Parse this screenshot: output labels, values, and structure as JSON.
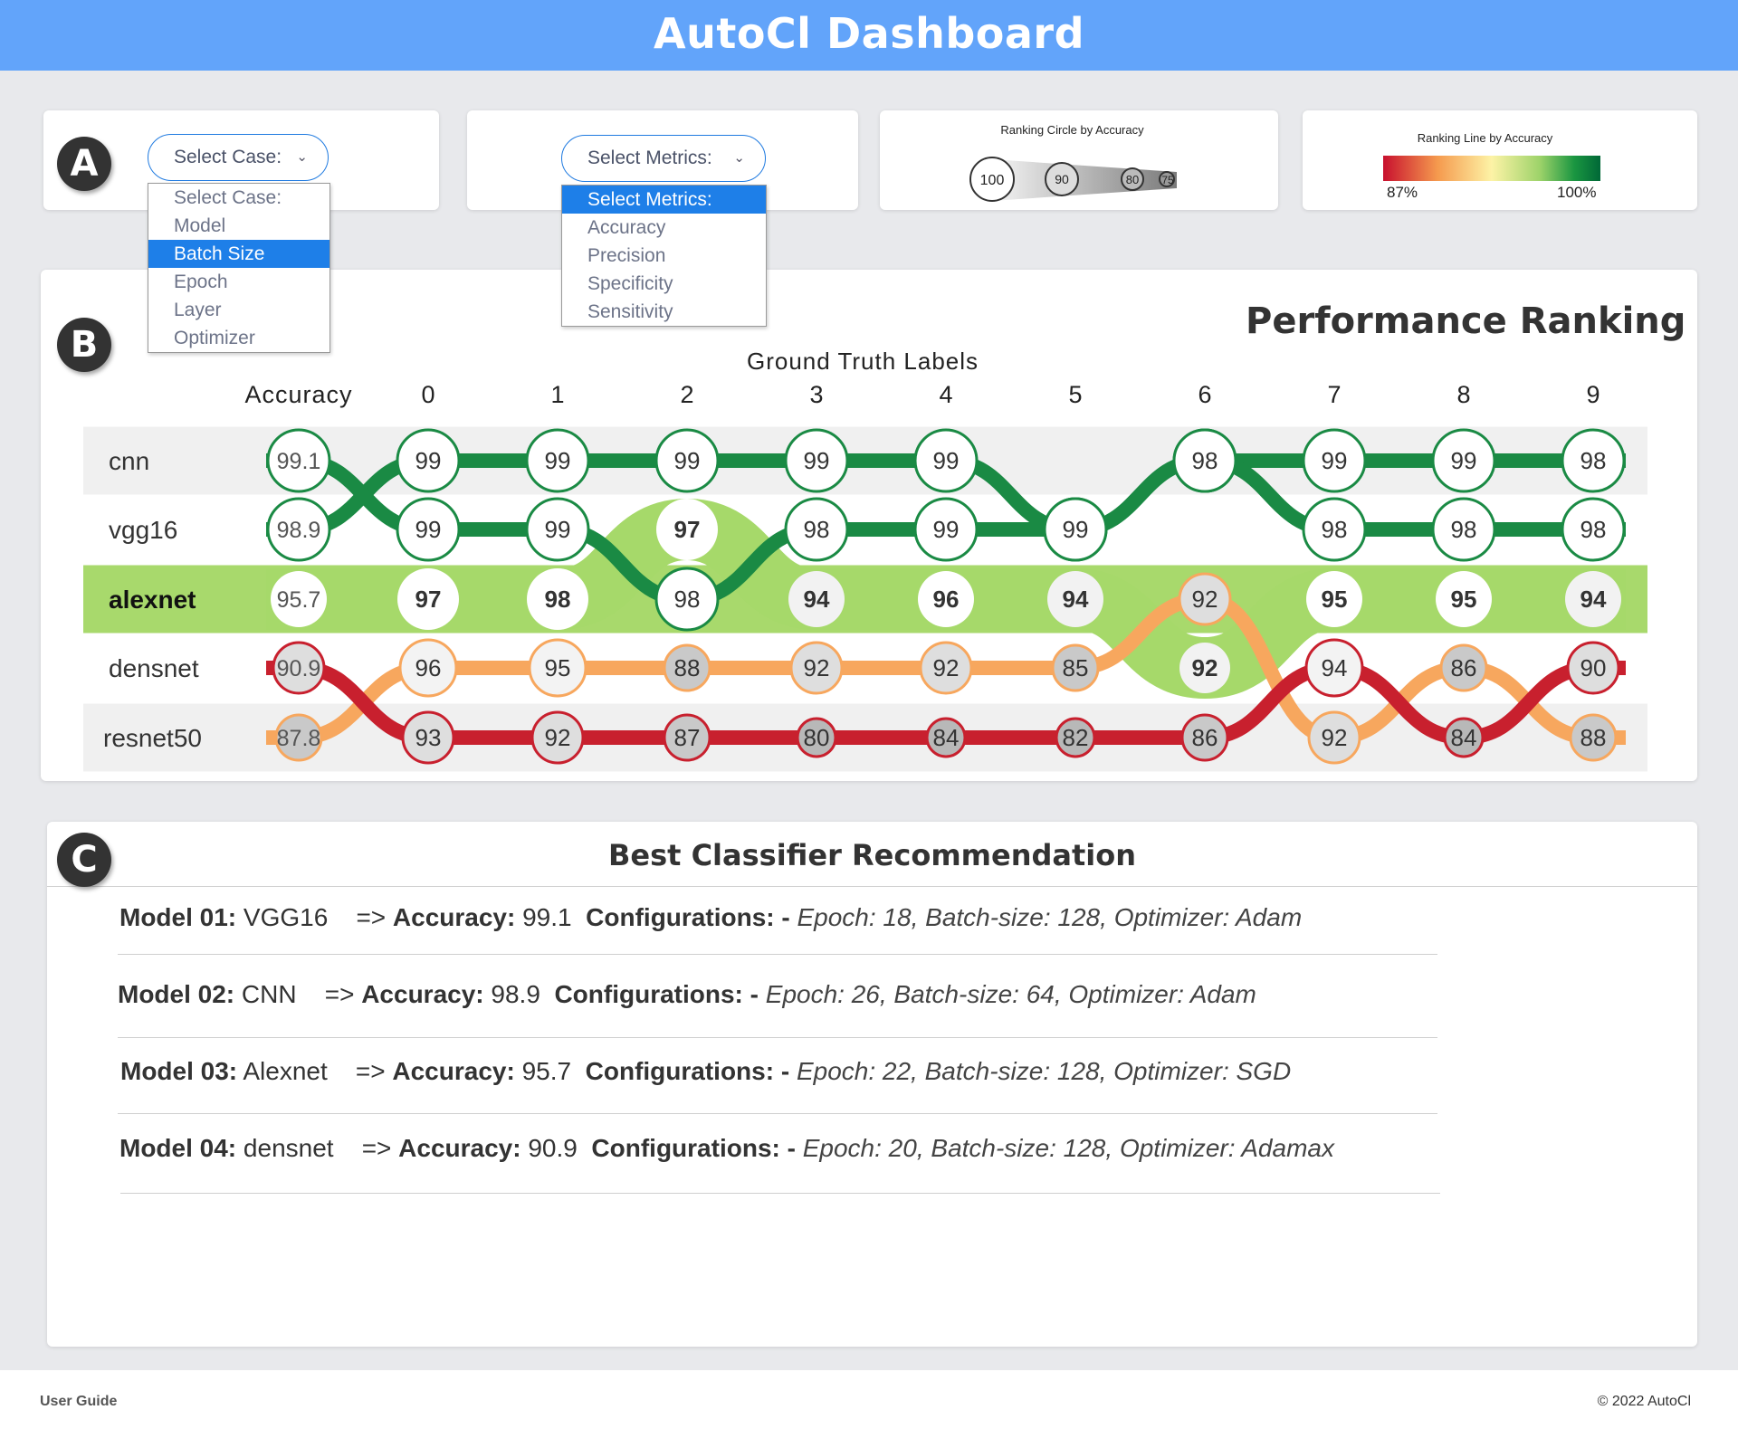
{
  "header": {
    "title": "AutoCl Dashboard"
  },
  "badges": {
    "a": "A",
    "b": "B",
    "c": "C"
  },
  "case_select": {
    "label": "Select Case:",
    "options": [
      "Select Case:",
      "Model",
      "Batch Size",
      "Epoch",
      "Layer",
      "Optimizer"
    ],
    "selected": "Batch Size"
  },
  "metrics_select": {
    "label": "Select Metrics:",
    "options": [
      "Select Metrics:",
      "Accuracy",
      "Precision",
      "Specificity",
      "Sensitivity"
    ],
    "selected": "Select Metrics:"
  },
  "ranking_circle_legend": {
    "title": "Ranking Circle by Accuracy",
    "values": [
      "100",
      "90",
      "80",
      "75"
    ]
  },
  "ranking_line_legend": {
    "title": "Ranking Line by Accuracy",
    "min_label": "87%",
    "max_label": "100%",
    "colors": [
      "#c8102e",
      "#f59a4e",
      "#fdf3a6",
      "#9ed36a",
      "#1a9641",
      "#006837"
    ]
  },
  "performance": {
    "title": "Performance Ranking",
    "subtitle": "Ground Truth Labels",
    "accuracy_header": "Accuracy",
    "columns": [
      "0",
      "1",
      "2",
      "3",
      "4",
      "5",
      "6",
      "7",
      "8",
      "9"
    ],
    "highlight_row": "alexnet",
    "row_labels": [
      "cnn",
      "vgg16",
      "alexnet",
      "densnet",
      "resnet50"
    ],
    "models": [
      {
        "name": "cnn",
        "color": "#1a8a44",
        "accuracy": "98.9",
        "ranks": [
          1,
          0,
          0,
          0,
          0,
          0,
          1,
          0,
          0,
          0,
          0
        ],
        "values": [
          "99",
          "99",
          "99",
          "99",
          "99",
          "99",
          "99",
          "99",
          "99",
          "98"
        ]
      },
      {
        "name": "vgg16",
        "color": "#1a8a44",
        "accuracy": "99.1",
        "ranks": [
          0,
          1,
          1,
          2,
          1,
          1,
          1,
          0,
          1,
          1,
          1
        ],
        "values": [
          "99",
          "99",
          "98",
          "98",
          "99",
          "99",
          "98",
          "98",
          "98",
          "98"
        ]
      },
      {
        "name": "alexnet",
        "color": "#a6d96a",
        "accuracy": "95.7",
        "ranks": [
          2,
          2,
          2,
          1,
          2,
          2,
          2,
          3,
          2,
          2,
          2
        ],
        "values": [
          "97",
          "98",
          "97",
          "94",
          "96",
          "94",
          "92",
          "95",
          "95",
          "94"
        ]
      },
      {
        "name": "densnet",
        "color": "#f7a75e",
        "accuracy": "87.8",
        "ranks": [
          4,
          3,
          3,
          3,
          3,
          3,
          3,
          2,
          4,
          3,
          4
        ],
        "values": [
          "96",
          "95",
          "88",
          "92",
          "92",
          "85",
          "92",
          "92",
          "86",
          "88"
        ]
      },
      {
        "name": "resnet50",
        "color": "#c8202e",
        "accuracy": "90.9",
        "ranks": [
          3,
          4,
          4,
          4,
          4,
          4,
          4,
          4,
          3,
          4,
          3
        ],
        "values": [
          "93",
          "92",
          "87",
          "80",
          "84",
          "82",
          "86",
          "94",
          "84",
          "90"
        ]
      }
    ]
  },
  "recommendation": {
    "title": "Best Classifier Recommendation",
    "items": [
      {
        "model_label": "Model 01:",
        "model": " VGG16",
        "acc_prefix": "=> ",
        "acc_label": "Accuracy:",
        "acc": " 99.1",
        "config_label": "Configurations: -",
        "config": " Epoch: 18, Batch-size: 128, Optimizer: Adam"
      },
      {
        "model_label": "Model 02:",
        "model": " CNN",
        "acc_prefix": "=> ",
        "acc_label": "Accuracy:",
        "acc": " 98.9",
        "config_label": "Configurations: -",
        "config": " Epoch: 26, Batch-size: 64, Optimizer: Adam"
      },
      {
        "model_label": "Model 03:",
        "model": " Alexnet",
        "acc_prefix": "=> ",
        "acc_label": "Accuracy:",
        "acc": " 95.7",
        "config_label": "Configurations: -",
        "config": " Epoch: 22, Batch-size: 128, Optimizer: SGD"
      },
      {
        "model_label": "Model 04:",
        "model": " densnet",
        "acc_prefix": "=> ",
        "acc_label": "Accuracy:",
        "acc": " 90.9",
        "config_label": "Configurations: -",
        "config": " Epoch: 20, Batch-size: 128, Optimizer: Adamax"
      }
    ]
  },
  "footer": {
    "user_guide": "User Guide",
    "copyright": "©  2022 AutoCl"
  }
}
